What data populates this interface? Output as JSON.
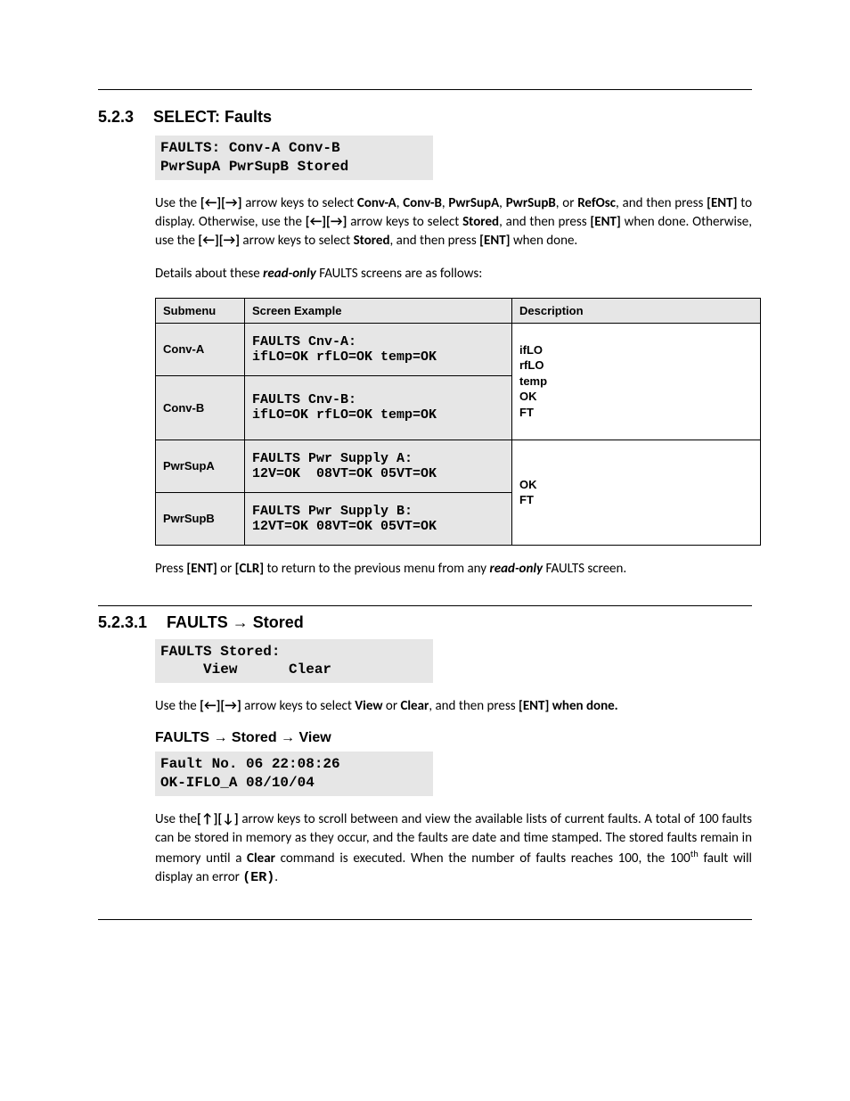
{
  "section1": {
    "num": "5.2.3",
    "title": "SELECT: Faults",
    "screen": "FAULTS: Conv-A Conv-B\nPwrSupA PwrSupB Stored"
  },
  "para1_parts": {
    "t0": "Use the ",
    "keys1": "[←][→]",
    "t1": " arrow keys to select ",
    "b1": "Conv-A",
    "t2": ", ",
    "b2": "Conv-B",
    "t3": ",  ",
    "b3": "PwrSupA",
    "t4": ", ",
    "b4": "PwrSupB",
    "t5": ", or ",
    "b5": "RefOsc",
    "t6": ", and then press ",
    "b6": "[ENT]",
    "t7": " to display. Otherwise, use the ",
    "keys2": "[←][→]",
    "t8": " arrow keys to select ",
    "b7": "Stored",
    "t9": ", and then press ",
    "b8": "[ENT]",
    "t10": " when done. Otherwise, use the ",
    "keys3": "[←][→]",
    "t11": " arrow keys to select ",
    "b9": "Stored",
    "t12": ", and then press ",
    "b10": "[ENT]",
    "t13": " when done."
  },
  "para2_parts": {
    "t0": "Details about these ",
    "bi": "read-only",
    "t1": " FAULTS screens are as follows:"
  },
  "table": {
    "heads": {
      "c1": "Submenu",
      "c2": "Screen Example",
      "c3": "Description"
    },
    "rows": [
      {
        "submenu": "Conv-A",
        "screen": "FAULTS Cnv-A:\nifLO=OK rfLO=OK temp=OK"
      },
      {
        "submenu": "Conv-B",
        "screen": "FAULTS Cnv-B:\nifLO=OK rfLO=OK temp=OK"
      },
      {
        "submenu": "PwrSupA",
        "screen": "FAULTS Pwr Supply A:\n12V=OK  08VT=OK 05VT=OK"
      },
      {
        "submenu": "PwrSupB",
        "screen": "FAULTS Pwr Supply B:\n12VT=OK 08VT=OK 05VT=OK"
      }
    ],
    "desc1": "ifLO\nrfLO\ntemp\nOK\nFT",
    "desc2": "OK\nFT"
  },
  "para3_parts": {
    "t0": "Press ",
    "b1": "[ENT]",
    "t1": " or ",
    "b2": "[CLR]",
    "t2": " to return to the previous menu from any ",
    "bi": "read-only",
    "t3": " FAULTS screen."
  },
  "section2": {
    "num": "5.2.3.1",
    "title_pre": "FAULTS ",
    "arrow": "→",
    "title_post": " Stored",
    "screen": "FAULTS Stored:\n     View      Clear"
  },
  "para4_parts": {
    "t0": "Use the ",
    "keys": "[←][→]",
    "t1": " arrow keys to select ",
    "b1": "View",
    "t2": " or ",
    "b2": "Clear",
    "t3": ", and then press ",
    "b3": "[ENT] when done."
  },
  "sub_view": {
    "pre": "FAULTS ",
    "arrow1": "→",
    "mid": " Stored ",
    "arrow2": "→",
    "post": " View",
    "screen": "Fault No. 06 22:08:26\nOK-IFLO_A 08/10/04"
  },
  "para5_parts": {
    "t0": "Use the",
    "keys": "[↑][↓]",
    "t1": " arrow keys to scroll between and view the available lists of current faults. A total of 100 faults can be stored in memory as they occur, and the faults are date and time stamped. The stored faults remain in memory until a ",
    "b1": "Clear",
    "t2": " command is executed. When the number of faults reaches 100, the 100",
    "sup": "th",
    "t3": " fault will display an error ",
    "b2": "(ER)",
    "t4": "."
  }
}
